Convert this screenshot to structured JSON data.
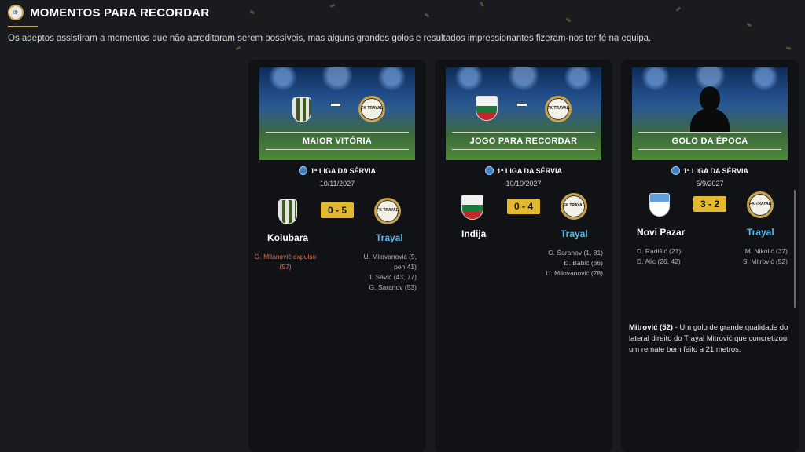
{
  "header": {
    "title": "MOMENTOS PARA RECORDAR",
    "subtitle": "Os adeptos assistiram a momentos que não acreditaram serem possíveis, mas alguns grandes golos e resultados impressionantes fizeram-nos ter fé na equipa.",
    "icon": "game-logo-icon"
  },
  "cards": [
    {
      "label": "MAIOR VITÓRIA",
      "league": "1ª LIGA DA SÉRVIA",
      "date": "10/11/2027",
      "home_team": "Kolubara",
      "away_team": "Trayal",
      "score": "0 - 5",
      "home_scorers": [
        "O. Milanović expulso",
        "(57)"
      ],
      "away_scorers": [
        "U. Milovanović (9,",
        "pen 41)",
        "I. Savić (43, 77)",
        "G. Saranov (53)"
      ]
    },
    {
      "label": "JOGO PARA RECORDAR",
      "league": "1ª LIGA DA SÉRVIA",
      "date": "10/10/2027",
      "home_team": "Indija",
      "away_team": "Trayal",
      "score": "0 - 4",
      "home_scorers": [],
      "away_scorers": [
        "G. Šaranov (1, 81)",
        "Đ. Babić (66)",
        "U. Milovanović (78)"
      ]
    },
    {
      "label": "GOLO DA ÉPOCA",
      "league": "1ª LIGA DA SÉRVIA",
      "date": "5/9/2027",
      "home_team": "Novi Pazar",
      "away_team": "Trayal",
      "score": "3 - 2",
      "home_scorers": [
        "D. Radišić (21)",
        "D. Alic (26, 42)"
      ],
      "away_scorers": [
        "M. Nikolić (37)",
        "S. Mitrović (52)"
      ],
      "description_bold": "Mitrović (52)",
      "description": " - Um golo de grande qualidade do lateral direito do Trayal Mitrović que concretizou um remate bem feito a 21 metros."
    }
  ],
  "crest_text": {
    "trayal": "FK TRAYAL",
    "kolubara_year": "1919"
  },
  "colors": {
    "background": "#1a1b1f",
    "card": "#111215",
    "score_bg": "#e3b92f",
    "away_team": "#58b9e8",
    "red_card": "#e16d4e",
    "accent": "#c9a94b"
  }
}
